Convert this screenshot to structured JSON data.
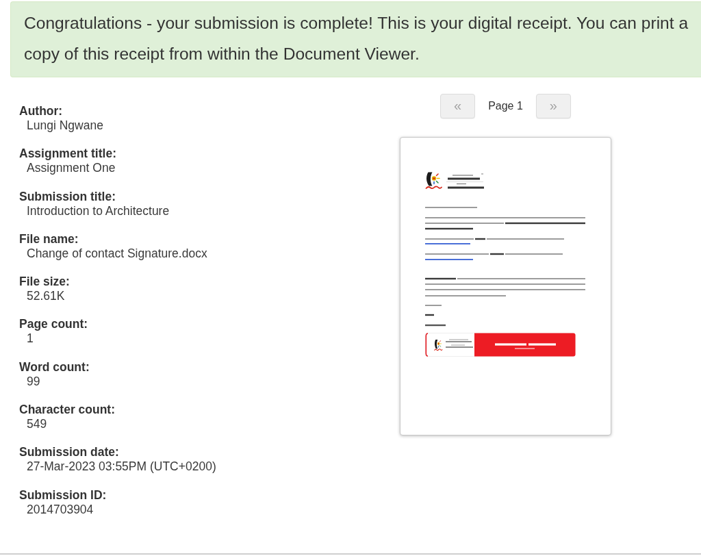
{
  "alert": {
    "text": "Congratulations - your submission is complete! This is your digital receipt. You can print a copy of this receipt from within the Document Viewer."
  },
  "details": [
    {
      "label": "Author:",
      "value": "Lungi Ngwane"
    },
    {
      "label": "Assignment title:",
      "value": "Assignment One"
    },
    {
      "label": "Submission title:",
      "value": "Introduction to Architecture"
    },
    {
      "label": "File name:",
      "value": "Change of contact Signature.docx"
    },
    {
      "label": "File size:",
      "value": "52.61K"
    },
    {
      "label": "Page count:",
      "value": "1"
    },
    {
      "label": "Word count:",
      "value": "99"
    },
    {
      "label": "Character count:",
      "value": "549"
    },
    {
      "label": "Submission date:",
      "value": "27-Mar-2023 03:55PM (UTC+0200)"
    },
    {
      "label": "Submission ID:",
      "value": "2014703904"
    }
  ],
  "pager": {
    "previous": {
      "symbol": "«",
      "disabled": true
    },
    "page_label": "Page 1",
    "next": {
      "symbol": "»",
      "disabled": true
    }
  }
}
